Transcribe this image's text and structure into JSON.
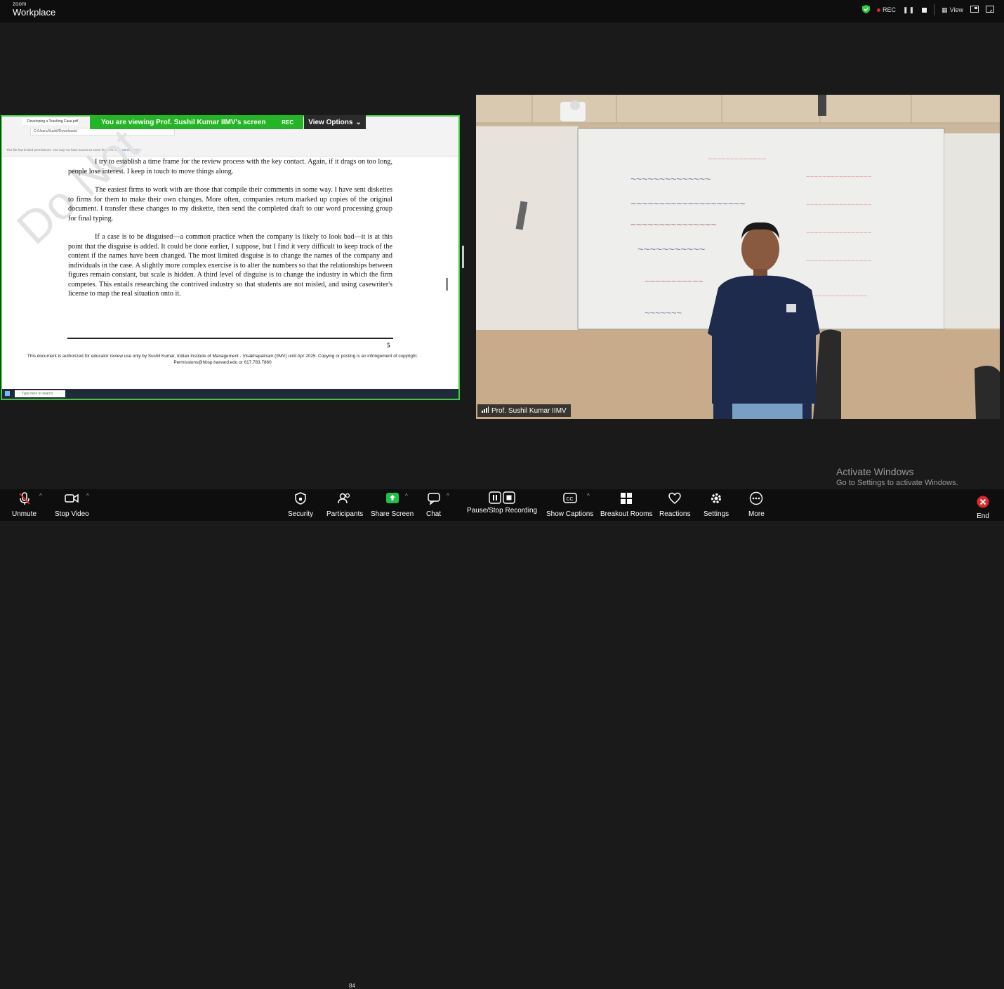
{
  "app": {
    "brand_small": "zoom",
    "brand": "Workplace"
  },
  "top_right": {
    "rec_label": "REC",
    "view_label": "View"
  },
  "share_banner": {
    "text": "You are viewing  Prof. Sushil Kumar IIMV's screen",
    "rec": "REC",
    "view_options": "View Options"
  },
  "shared_browser": {
    "tab_title": "Developing a Teaching Case.pdf",
    "address": "C:/Users/Sushil/Downloads/",
    "notice": "This file has limited permissions. You may not have access to some features.",
    "notice_link": "View permissions",
    "taskbar_search": "Type here to search"
  },
  "document": {
    "paragraphs": [
      "I try to establish a time frame for the review process with the key contact.  Again, if it drags on too long, people lose interest.  I keep in touch to move things along.",
      "The easiest firms to work with are those that compile their comments in some way.  I have sent diskettes to firms for them to make their own changes.  More often, companies return marked up copies of the original document.  I transfer these changes to my diskette, then send the completed draft to our word processing group for final typing.",
      "If a case is to be disguised—a common practice when the company is likely to look bad—it is at this point that the disguise is added.  It could be done earlier, I suppose, but I find it very difficult to keep track of the content if the names have been changed.  The most limited disguise is to change the names of the company and individuals in the case.  A slightly more complex exercise is to alter the numbers so that the relationships between figures remain constant, but scale is hidden.  A third level of disguise is to change the industry in which the firm competes. This entails researching the contrived industry so that students are not misled, and using casewriter's license to map the real situation onto it."
    ],
    "watermark": "Do Not",
    "page_number": "5",
    "footer": "This document is authorized for educator review use only by Sushil Kumar, Indian Institute of Management - Visakhapatnam (IIMV) until Apr 2025. Copying or posting is an infringement of copyright. Permissions@hbsp.harvard.edu or 617.783.7860"
  },
  "video": {
    "participant_name": "Prof. Sushil Kumar IIMV"
  },
  "activate_windows": {
    "title": "Activate Windows",
    "subtitle": "Go to Settings to activate Windows."
  },
  "toolbar": {
    "unmute": "Unmute",
    "stop_video": "Stop Video",
    "security": "Security",
    "participants": "Participants",
    "participants_count": "84",
    "share_screen": "Share Screen",
    "chat": "Chat",
    "recording": "Pause/Stop Recording",
    "captions": "Show Captions",
    "breakout": "Breakout Rooms",
    "reactions": "Reactions",
    "settings": "Settings",
    "more": "More",
    "end": "End"
  },
  "colors": {
    "share_border": "#3ccf3c",
    "share_banner": "#23b523",
    "end_red": "#e02828",
    "share_screen_green": "#1fbf4a"
  }
}
